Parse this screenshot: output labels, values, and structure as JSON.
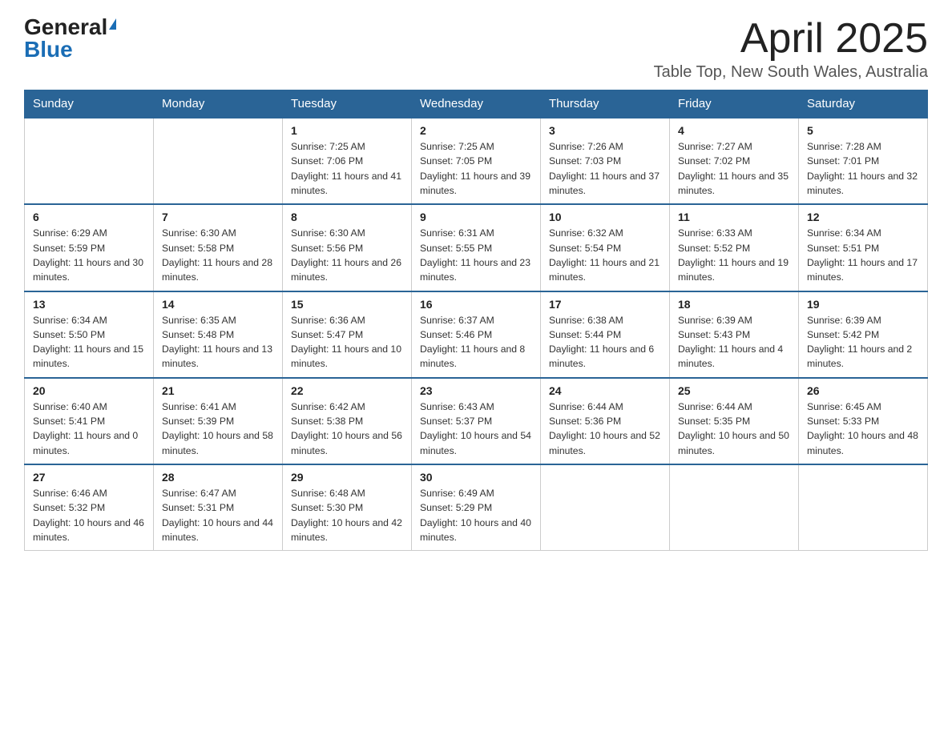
{
  "logo": {
    "general": "General",
    "blue": "Blue"
  },
  "header": {
    "month": "April 2025",
    "location": "Table Top, New South Wales, Australia"
  },
  "weekdays": [
    "Sunday",
    "Monday",
    "Tuesday",
    "Wednesday",
    "Thursday",
    "Friday",
    "Saturday"
  ],
  "weeks": [
    [
      {
        "day": "",
        "empty": true
      },
      {
        "day": "",
        "empty": true
      },
      {
        "day": "1",
        "sunrise": "7:25 AM",
        "sunset": "7:06 PM",
        "daylight": "11 hours and 41 minutes."
      },
      {
        "day": "2",
        "sunrise": "7:25 AM",
        "sunset": "7:05 PM",
        "daylight": "11 hours and 39 minutes."
      },
      {
        "day": "3",
        "sunrise": "7:26 AM",
        "sunset": "7:03 PM",
        "daylight": "11 hours and 37 minutes."
      },
      {
        "day": "4",
        "sunrise": "7:27 AM",
        "sunset": "7:02 PM",
        "daylight": "11 hours and 35 minutes."
      },
      {
        "day": "5",
        "sunrise": "7:28 AM",
        "sunset": "7:01 PM",
        "daylight": "11 hours and 32 minutes."
      }
    ],
    [
      {
        "day": "6",
        "sunrise": "6:29 AM",
        "sunset": "5:59 PM",
        "daylight": "11 hours and 30 minutes."
      },
      {
        "day": "7",
        "sunrise": "6:30 AM",
        "sunset": "5:58 PM",
        "daylight": "11 hours and 28 minutes."
      },
      {
        "day": "8",
        "sunrise": "6:30 AM",
        "sunset": "5:56 PM",
        "daylight": "11 hours and 26 minutes."
      },
      {
        "day": "9",
        "sunrise": "6:31 AM",
        "sunset": "5:55 PM",
        "daylight": "11 hours and 23 minutes."
      },
      {
        "day": "10",
        "sunrise": "6:32 AM",
        "sunset": "5:54 PM",
        "daylight": "11 hours and 21 minutes."
      },
      {
        "day": "11",
        "sunrise": "6:33 AM",
        "sunset": "5:52 PM",
        "daylight": "11 hours and 19 minutes."
      },
      {
        "day": "12",
        "sunrise": "6:34 AM",
        "sunset": "5:51 PM",
        "daylight": "11 hours and 17 minutes."
      }
    ],
    [
      {
        "day": "13",
        "sunrise": "6:34 AM",
        "sunset": "5:50 PM",
        "daylight": "11 hours and 15 minutes."
      },
      {
        "day": "14",
        "sunrise": "6:35 AM",
        "sunset": "5:48 PM",
        "daylight": "11 hours and 13 minutes."
      },
      {
        "day": "15",
        "sunrise": "6:36 AM",
        "sunset": "5:47 PM",
        "daylight": "11 hours and 10 minutes."
      },
      {
        "day": "16",
        "sunrise": "6:37 AM",
        "sunset": "5:46 PM",
        "daylight": "11 hours and 8 minutes."
      },
      {
        "day": "17",
        "sunrise": "6:38 AM",
        "sunset": "5:44 PM",
        "daylight": "11 hours and 6 minutes."
      },
      {
        "day": "18",
        "sunrise": "6:39 AM",
        "sunset": "5:43 PM",
        "daylight": "11 hours and 4 minutes."
      },
      {
        "day": "19",
        "sunrise": "6:39 AM",
        "sunset": "5:42 PM",
        "daylight": "11 hours and 2 minutes."
      }
    ],
    [
      {
        "day": "20",
        "sunrise": "6:40 AM",
        "sunset": "5:41 PM",
        "daylight": "11 hours and 0 minutes."
      },
      {
        "day": "21",
        "sunrise": "6:41 AM",
        "sunset": "5:39 PM",
        "daylight": "10 hours and 58 minutes."
      },
      {
        "day": "22",
        "sunrise": "6:42 AM",
        "sunset": "5:38 PM",
        "daylight": "10 hours and 56 minutes."
      },
      {
        "day": "23",
        "sunrise": "6:43 AM",
        "sunset": "5:37 PM",
        "daylight": "10 hours and 54 minutes."
      },
      {
        "day": "24",
        "sunrise": "6:44 AM",
        "sunset": "5:36 PM",
        "daylight": "10 hours and 52 minutes."
      },
      {
        "day": "25",
        "sunrise": "6:44 AM",
        "sunset": "5:35 PM",
        "daylight": "10 hours and 50 minutes."
      },
      {
        "day": "26",
        "sunrise": "6:45 AM",
        "sunset": "5:33 PM",
        "daylight": "10 hours and 48 minutes."
      }
    ],
    [
      {
        "day": "27",
        "sunrise": "6:46 AM",
        "sunset": "5:32 PM",
        "daylight": "10 hours and 46 minutes."
      },
      {
        "day": "28",
        "sunrise": "6:47 AM",
        "sunset": "5:31 PM",
        "daylight": "10 hours and 44 minutes."
      },
      {
        "day": "29",
        "sunrise": "6:48 AM",
        "sunset": "5:30 PM",
        "daylight": "10 hours and 42 minutes."
      },
      {
        "day": "30",
        "sunrise": "6:49 AM",
        "sunset": "5:29 PM",
        "daylight": "10 hours and 40 minutes."
      },
      {
        "day": "",
        "empty": true
      },
      {
        "day": "",
        "empty": true
      },
      {
        "day": "",
        "empty": true
      }
    ]
  ],
  "labels": {
    "sunrise": "Sunrise: ",
    "sunset": "Sunset: ",
    "daylight": "Daylight: "
  }
}
